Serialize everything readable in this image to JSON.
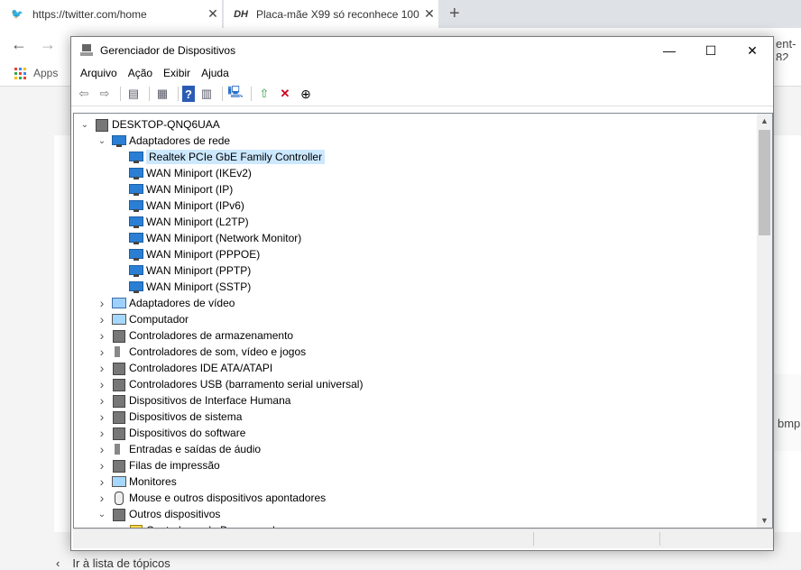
{
  "browser": {
    "tabs": [
      {
        "title": "https://twitter.com/home",
        "favicon": "twitter-icon",
        "close": "✕"
      },
      {
        "title": "Placa-mãe X99 só reconhece 100",
        "favicon": "dh-icon",
        "fav_text": "DH",
        "close": "✕"
      }
    ],
    "new_tab": "+",
    "bookmarks": {
      "apps_label": "Apps"
    },
    "url_fragment": "ent-82",
    "side_fragment": "bmp",
    "back_link": "Ir à lista de tópicos"
  },
  "window": {
    "title": "Gerenciador de Dispositivos",
    "menu": [
      "Arquivo",
      "Ação",
      "Exibir",
      "Ajuda"
    ],
    "tree": [
      {
        "label": "DESKTOP-QNQ6UAA",
        "level": 0,
        "expander": "v",
        "icon": "computer-icon"
      },
      {
        "label": "Adaptadores de rede",
        "level": 1,
        "expander": "v",
        "icon": "network-icon"
      },
      {
        "label": "Realtek PCIe GbE Family Controller",
        "level": 2,
        "expander": "",
        "icon": "network-icon",
        "selected": true
      },
      {
        "label": "WAN Miniport (IKEv2)",
        "level": 2,
        "expander": "",
        "icon": "network-icon"
      },
      {
        "label": "WAN Miniport (IP)",
        "level": 2,
        "expander": "",
        "icon": "network-icon"
      },
      {
        "label": "WAN Miniport (IPv6)",
        "level": 2,
        "expander": "",
        "icon": "network-icon"
      },
      {
        "label": "WAN Miniport (L2TP)",
        "level": 2,
        "expander": "",
        "icon": "network-icon"
      },
      {
        "label": "WAN Miniport (Network Monitor)",
        "level": 2,
        "expander": "",
        "icon": "network-icon"
      },
      {
        "label": "WAN Miniport (PPPOE)",
        "level": 2,
        "expander": "",
        "icon": "network-icon"
      },
      {
        "label": "WAN Miniport (PPTP)",
        "level": 2,
        "expander": "",
        "icon": "network-icon"
      },
      {
        "label": "WAN Miniport (SSTP)",
        "level": 2,
        "expander": "",
        "icon": "network-icon"
      },
      {
        "label": "Adaptadores de vídeo",
        "level": 1,
        "expander": ">",
        "icon": "display-adapter-icon"
      },
      {
        "label": "Computador",
        "level": 1,
        "expander": ">",
        "icon": "monitor-icon"
      },
      {
        "label": "Controladores de armazenamento",
        "level": 1,
        "expander": ">",
        "icon": "storage-icon"
      },
      {
        "label": "Controladores de som, vídeo e jogos",
        "level": 1,
        "expander": ">",
        "icon": "speaker-icon"
      },
      {
        "label": "Controladores IDE ATA/ATAPI",
        "level": 1,
        "expander": ">",
        "icon": "ide-icon"
      },
      {
        "label": "Controladores USB (barramento serial universal)",
        "level": 1,
        "expander": ">",
        "icon": "usb-icon"
      },
      {
        "label": "Dispositivos de Interface Humana",
        "level": 1,
        "expander": ">",
        "icon": "hid-icon"
      },
      {
        "label": "Dispositivos de sistema",
        "level": 1,
        "expander": ">",
        "icon": "system-icon"
      },
      {
        "label": "Dispositivos do software",
        "level": 1,
        "expander": ">",
        "icon": "software-device-icon"
      },
      {
        "label": "Entradas e saídas de áudio",
        "level": 1,
        "expander": ">",
        "icon": "speaker-icon"
      },
      {
        "label": "Filas de impressão",
        "level": 1,
        "expander": ">",
        "icon": "printer-icon"
      },
      {
        "label": "Monitores",
        "level": 1,
        "expander": ">",
        "icon": "monitor-icon"
      },
      {
        "label": "Mouse e outros dispositivos apontadores",
        "level": 1,
        "expander": ">",
        "icon": "mouse-icon"
      },
      {
        "label": "Outros dispositivos",
        "level": 1,
        "expander": "v",
        "icon": "other-devices-icon"
      },
      {
        "label": "Contadores de Desempenho",
        "level": 2,
        "expander": "",
        "icon": "warning-device-icon"
      }
    ]
  }
}
